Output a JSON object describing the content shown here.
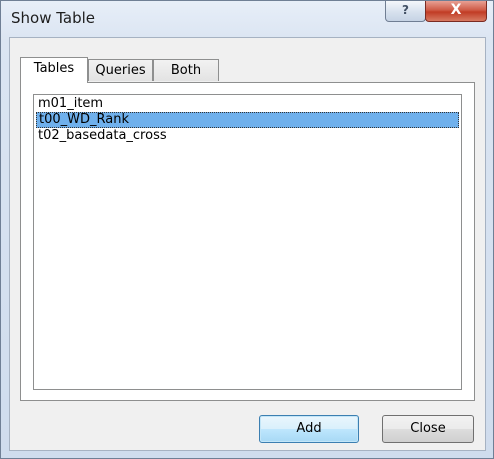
{
  "window": {
    "title": "Show Table",
    "help_glyph": "?",
    "close_glyph": "X"
  },
  "tabs": [
    {
      "label": "Tables",
      "selected": true
    },
    {
      "label": "Queries",
      "selected": false
    },
    {
      "label": "Both",
      "selected": false
    }
  ],
  "list": {
    "items": [
      {
        "label": "m01_item",
        "selected": false
      },
      {
        "label": "t00_WD_Rank",
        "selected": true
      },
      {
        "label": "t02_basedata_cross",
        "selected": false
      }
    ]
  },
  "buttons": {
    "add_label": "Add",
    "close_label": "Close"
  },
  "colors": {
    "selection": "#6fb0ec",
    "close_button": "#c13c25"
  }
}
